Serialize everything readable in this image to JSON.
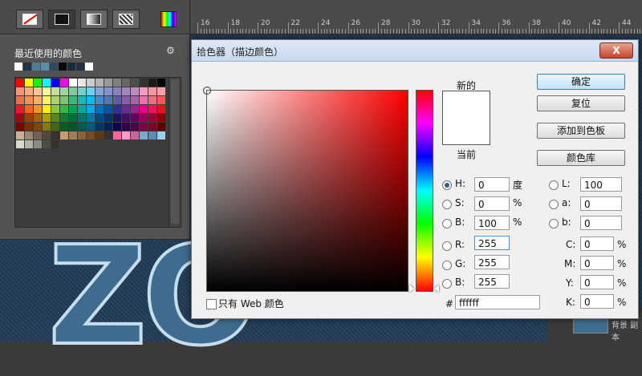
{
  "ruler": {
    "labels": [
      "16",
      "18",
      "20",
      "22",
      "24",
      "26",
      "28",
      "30",
      "32",
      "34",
      "36",
      "38",
      "40",
      "42",
      "44"
    ]
  },
  "canvas": {
    "art_text": "ZO"
  },
  "layers_strip": {
    "label": "背景 副本"
  },
  "swatches_panel": {
    "header": "最近使用的颜色",
    "gear": "⚙",
    "recent_colors": [
      "#ffffff",
      "#223344",
      "#4d7e96",
      "#5b8fa6",
      "#2c4b5c",
      "#0a0a0a",
      "#1a2a3a",
      "#223040",
      "#ffffff"
    ],
    "grid_colors": [
      "#ff0000",
      "#ffff00",
      "#00ff00",
      "#00ffff",
      "#0000ff",
      "#ff00ff",
      "#ffffff",
      "#e6e6e6",
      "#cccccc",
      "#b3b3b3",
      "#999999",
      "#808080",
      "#666666",
      "#4d4d4d",
      "#333333",
      "#1a1a1a",
      "#000000",
      "#f7977a",
      "#f9ad81",
      "#fdc68a",
      "#fff79a",
      "#c4df9b",
      "#a2d39c",
      "#82ca9d",
      "#7bcdc8",
      "#6ecff6",
      "#7ea7d8",
      "#8493ca",
      "#8882be",
      "#a187be",
      "#bc8dbf",
      "#f49ac2",
      "#f6989d",
      "#f5a3a3",
      "#f26c4f",
      "#f68e55",
      "#fbaf5c",
      "#fff467",
      "#acd372",
      "#7cc576",
      "#3bb878",
      "#1abbb4",
      "#00bff3",
      "#438ccb",
      "#5574b9",
      "#605ca8",
      "#855fa8",
      "#a763a8",
      "#f06ea9",
      "#f26d7d",
      "#ef5b5b",
      "#ed1c24",
      "#f26522",
      "#f7941d",
      "#fff200",
      "#8dc63f",
      "#39b54a",
      "#00a651",
      "#00a99d",
      "#00aeef",
      "#0072bc",
      "#0054a6",
      "#2e3192",
      "#662d91",
      "#92278f",
      "#ec008c",
      "#ed145b",
      "#d71920",
      "#9e0b0f",
      "#a0410d",
      "#a36209",
      "#aba000",
      "#598527",
      "#1a7b30",
      "#007236",
      "#00746b",
      "#0076a3",
      "#004b80",
      "#003471",
      "#1b1464",
      "#440e62",
      "#630460",
      "#9e005d",
      "#9e0039",
      "#8b0000",
      "#790000",
      "#7b2e00",
      "#7d4900",
      "#827b00",
      "#406618",
      "#005e20",
      "#005826",
      "#005952",
      "#005b7f",
      "#003663",
      "#002157",
      "#0d004c",
      "#32004b",
      "#4b0049",
      "#7b0046",
      "#7a0026",
      "#5c0000",
      "#c7b299",
      "#998675",
      "#736357",
      "#534741",
      "#37302d",
      "#c69c6d",
      "#a67c52",
      "#8c6239",
      "#754c24",
      "#603913",
      "#362f2d",
      "#ff6699",
      "#ff99cc",
      "#cc6699",
      "#7fa8c9",
      "#5c8db5",
      "#9ad0f5",
      "#d9d9c9",
      "#b3b3a6",
      "#8c8c80",
      "#4d4d40",
      "#333326"
    ]
  },
  "dialog": {
    "title": "拾色器（描边颜色）",
    "close": "X",
    "label_new": "新的",
    "label_current": "当前",
    "buttons": {
      "ok": "确定",
      "reset": "复位",
      "add_swatch": "添加到色板",
      "color_library": "颜色库"
    },
    "hsb": {
      "h": {
        "label": "H:",
        "value": "0",
        "unit": "度"
      },
      "s": {
        "label": "S:",
        "value": "0",
        "unit": "%"
      },
      "b": {
        "label": "B:",
        "value": "100",
        "unit": "%"
      }
    },
    "rgb": {
      "r": {
        "label": "R:",
        "value": "255"
      },
      "g": {
        "label": "G:",
        "value": "255"
      },
      "b": {
        "label": "B:",
        "value": "255"
      }
    },
    "lab": {
      "l": {
        "label": "L:",
        "value": "100"
      },
      "a": {
        "label": "a:",
        "value": "0"
      },
      "b": {
        "label": "b:",
        "value": "0"
      }
    },
    "cmyk": {
      "c": {
        "label": "C:",
        "value": "0",
        "unit": "%"
      },
      "m": {
        "label": "M:",
        "value": "0",
        "unit": "%"
      },
      "y": {
        "label": "Y:",
        "value": "0",
        "unit": "%"
      },
      "k": {
        "label": "K:",
        "value": "0",
        "unit": "%"
      }
    },
    "hex": {
      "label": "#",
      "value": "ffffff"
    },
    "web_only_label": "只有 Web 颜色",
    "preview_color": "#ffffff"
  }
}
